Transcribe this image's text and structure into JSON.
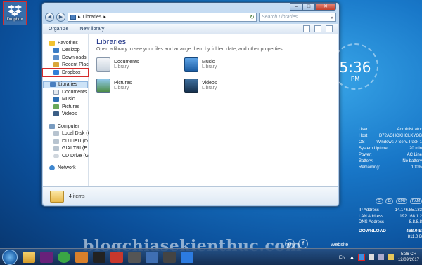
{
  "desktop": {
    "dropbox_label": "Dropbox"
  },
  "window": {
    "address": "Libraries",
    "search_placeholder": "Search Libraries",
    "toolbar": {
      "organize": "Organize",
      "new_library": "New library"
    },
    "nav": {
      "favorites": "Favorites",
      "fav_items": [
        "Desktop",
        "Downloads",
        "Recent Places",
        "Dropbox"
      ],
      "libraries": "Libraries",
      "lib_items": [
        "Documents",
        "Music",
        "Pictures",
        "Videos"
      ],
      "computer": "Computer",
      "drives": [
        "Local Disk (C:)",
        "DU LIEU (D:)",
        "GIAI TRI (E:)",
        "CD Drive (G:)"
      ],
      "network": "Network"
    },
    "content": {
      "title": "Libraries",
      "description": "Open a library to see your files and arrange them by folder, date, and other properties.",
      "libraries": [
        {
          "name": "Documents",
          "type": "Library"
        },
        {
          "name": "Music",
          "type": "Library"
        },
        {
          "name": "Pictures",
          "type": "Library"
        },
        {
          "name": "Videos",
          "type": "Library"
        }
      ]
    },
    "details": "4 items"
  },
  "clock_gadget": {
    "time": "5:36",
    "ampm": "PM"
  },
  "sysinfo": [
    {
      "k": "User",
      "v": "Administrator"
    },
    {
      "k": "Host",
      "v": "D72AOHCKHCLKYOB"
    },
    {
      "k": "OS",
      "v": "Windows 7 Serv. Pack 1"
    },
    {
      "k": "System Uptime:",
      "v": "20 min"
    },
    {
      "k": "Power:",
      "v": "AC Line"
    },
    {
      "k": "Battery:",
      "v": "No battery"
    },
    {
      "k": "Remaining:",
      "v": "100%"
    }
  ],
  "net_tabs": [
    "C:",
    "D:",
    "CPU",
    "RAM"
  ],
  "network": [
    {
      "k": "IP Address",
      "v": "14.176.85.133"
    },
    {
      "k": "LAN Address",
      "v": "192.168.1.2"
    },
    {
      "k": "DNS Address",
      "v": "8.8.8.8"
    }
  ],
  "download": {
    "label": "DOWNLOAD",
    "value": "468.0 B"
  },
  "upload_value": "811.0 B",
  "watermark": "blogchiasekienthuc.com",
  "website_label": "Website",
  "taskbar": {
    "lang": "EN",
    "time": "5:36 CH",
    "date": "12/09/2017"
  },
  "colors": {
    "highlight": "#d42b2b",
    "window_title_text": "#1e3287"
  }
}
